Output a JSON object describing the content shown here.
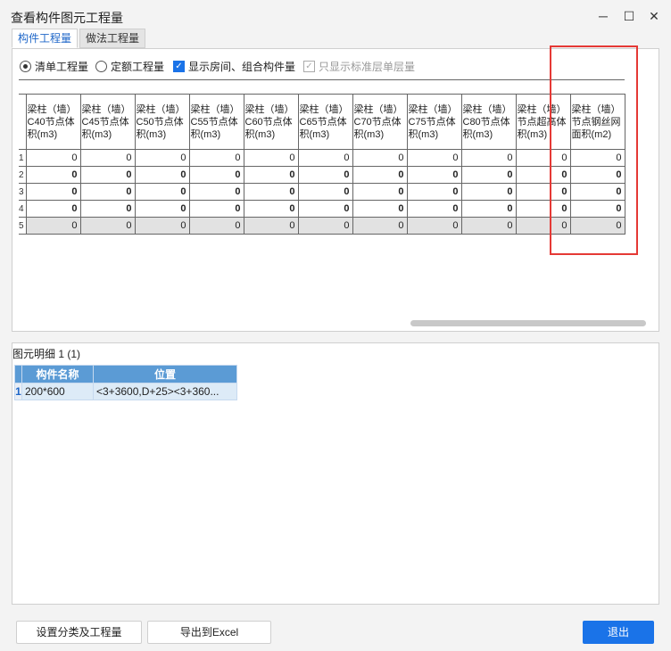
{
  "window": {
    "title": "查看构件图元工程量",
    "minimize": "─",
    "maximize": "☐",
    "close": "✕"
  },
  "tabs": [
    {
      "label": "构件工程量",
      "active": true
    },
    {
      "label": "做法工程量",
      "active": false
    }
  ],
  "options": {
    "list_qty": {
      "label": "清单工程量",
      "checked": true
    },
    "quota_qty": {
      "label": "定额工程量",
      "checked": false
    },
    "show_room": {
      "label": "显示房间、组合构件量",
      "checked": true
    },
    "std_floor": {
      "label": "只显示标准层单层量",
      "checked": true,
      "disabled": true
    }
  },
  "grid": {
    "columns": [
      "梁柱（墙）C40节点体积(m3)",
      "梁柱（墙）C45节点体积(m3)",
      "梁柱（墙）C50节点体积(m3)",
      "梁柱（墙）C55节点体积(m3)",
      "梁柱（墙）C60节点体积(m3)",
      "梁柱（墙）C65节点体积(m3)",
      "梁柱（墙）C70节点体积(m3)",
      "梁柱（墙）C75节点体积(m3)",
      "梁柱（墙）C80节点体积(m3)",
      "梁柱（墙）节点超高体积(m3)",
      "梁柱（墙）节点钢丝网面积(m2)"
    ],
    "rows": [
      {
        "num": "1",
        "values": [
          "0",
          "0",
          "0",
          "0",
          "0",
          "0",
          "0",
          "0",
          "0",
          "0",
          "0"
        ],
        "bold": false,
        "shade": false
      },
      {
        "num": "2",
        "values": [
          "0",
          "0",
          "0",
          "0",
          "0",
          "0",
          "0",
          "0",
          "0",
          "0",
          "0"
        ],
        "bold": true,
        "shade": false
      },
      {
        "num": "3",
        "values": [
          "0",
          "0",
          "0",
          "0",
          "0",
          "0",
          "0",
          "0",
          "0",
          "0",
          "0"
        ],
        "bold": true,
        "shade": false
      },
      {
        "num": "4",
        "values": [
          "0",
          "0",
          "0",
          "0",
          "0",
          "0",
          "0",
          "0",
          "0",
          "0",
          "0"
        ],
        "bold": true,
        "shade": false
      },
      {
        "num": "5",
        "values": [
          "0",
          "0",
          "0",
          "0",
          "0",
          "0",
          "0",
          "0",
          "0",
          "0",
          "0"
        ],
        "bold": false,
        "shade": true
      }
    ]
  },
  "detail": {
    "label": "图元明细  1 (1)",
    "headers": [
      "构件名称",
      "位置"
    ],
    "rows": [
      {
        "num": "1",
        "name": "200*600",
        "position": "<3+3600,D+25><3+360..."
      }
    ]
  },
  "buttons": {
    "settings": "设置分类及工程量",
    "export": "导出到Excel",
    "exit": "退出"
  },
  "colors": {
    "accent": "#1a73e8",
    "highlight_box": "#e53935",
    "detail_header": "#5b9bd5"
  }
}
